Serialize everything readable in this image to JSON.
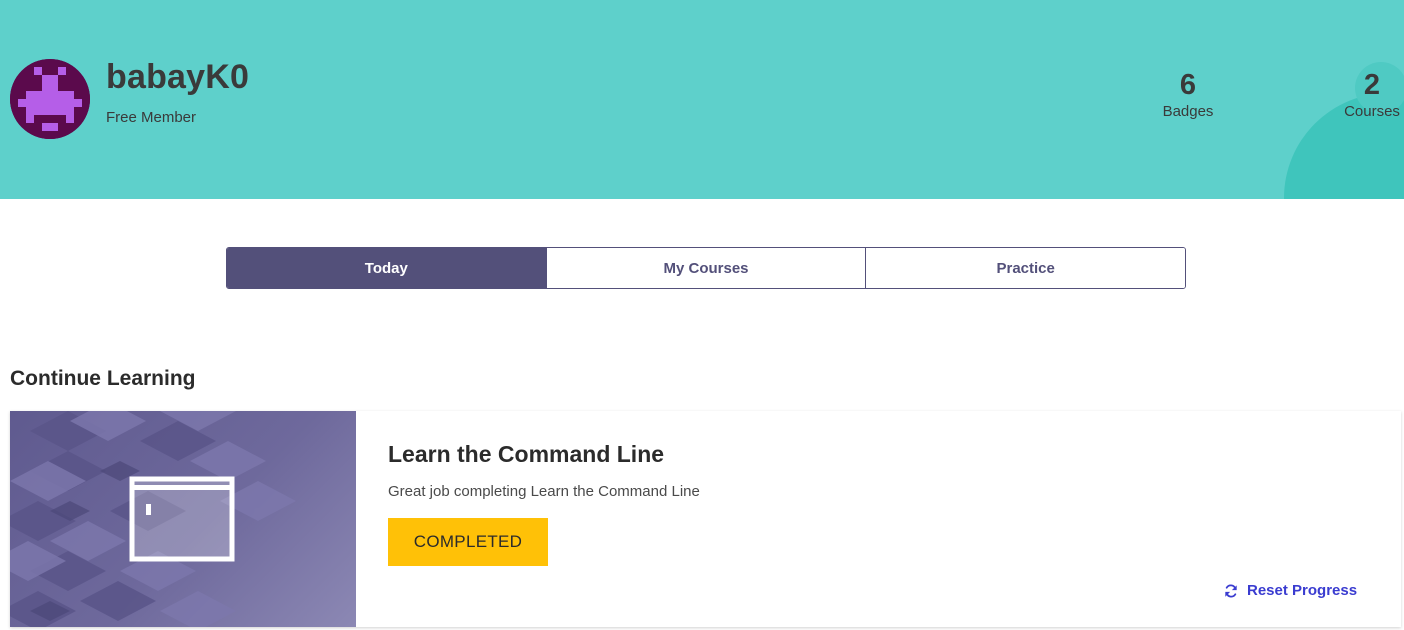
{
  "profile": {
    "username": "babayK0",
    "membership": "Free Member",
    "stats": [
      {
        "value": "6",
        "label": "Badges"
      },
      {
        "value": "2",
        "label": "Courses"
      }
    ]
  },
  "tabs": [
    {
      "label": "Today",
      "active": true
    },
    {
      "label": "My Courses",
      "active": false
    },
    {
      "label": "Practice",
      "active": false
    }
  ],
  "section": {
    "title": "Continue Learning"
  },
  "course_card": {
    "title": "Learn the Command Line",
    "description": "Great job completing Learn the Command Line",
    "status": "COMPLETED",
    "reset_label": "Reset Progress",
    "icons": [
      "terminal-window-icon",
      "refresh-icon"
    ]
  },
  "colors": {
    "header_bg": "#5ed0cb",
    "avatar_bg": "#5b0a4c",
    "avatar_pixels": "#b55ee8",
    "tab_accent": "#53507a",
    "completed_bg": "#ffc107",
    "link": "#3a3cd0",
    "course_art_bg": "#6e699c"
  }
}
